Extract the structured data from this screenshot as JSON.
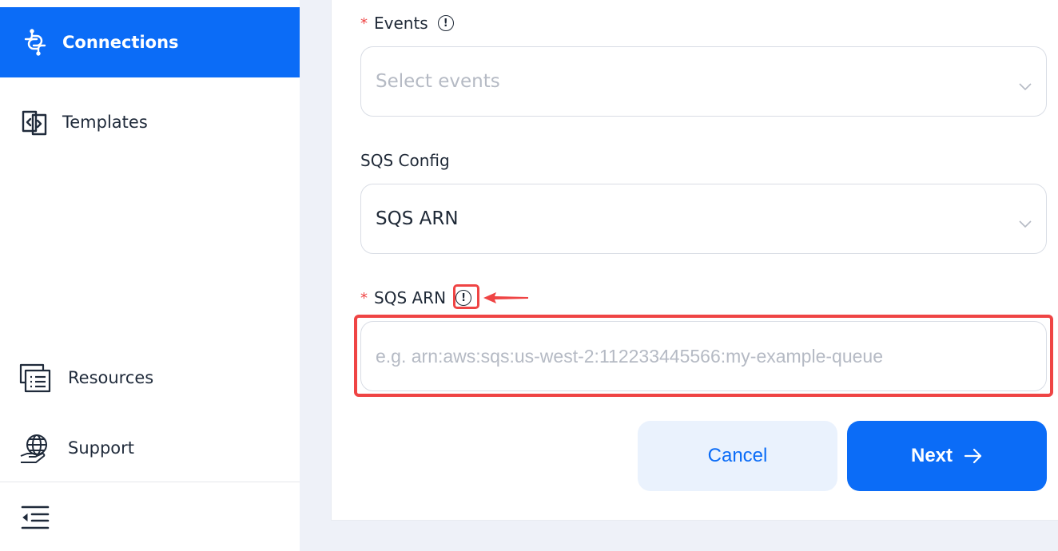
{
  "sidebar": {
    "items": [
      {
        "label": "Connections",
        "icon": "connections-icon",
        "active": true
      },
      {
        "label": "Templates",
        "icon": "templates-icon"
      },
      {
        "label": "Resources",
        "icon": "resources-icon"
      },
      {
        "label": "Support",
        "icon": "support-icon"
      }
    ],
    "collapse_icon": "collapse-menu-icon"
  },
  "form": {
    "events": {
      "label": "Events",
      "required_mark": "*",
      "placeholder": "Select events"
    },
    "sqs_config": {
      "label": "SQS Config",
      "value": "SQS ARN"
    },
    "sqs_arn": {
      "label": "SQS ARN",
      "required_mark": "*",
      "placeholder": "e.g. arn:aws:sqs:us-west-2:112233445566:my-example-queue",
      "value": ""
    },
    "info_glyph": "!"
  },
  "buttons": {
    "cancel": "Cancel",
    "next": "Next"
  },
  "colors": {
    "accent": "#0b6cf7",
    "annotation": "#ef4444",
    "required": "#ef4444"
  }
}
